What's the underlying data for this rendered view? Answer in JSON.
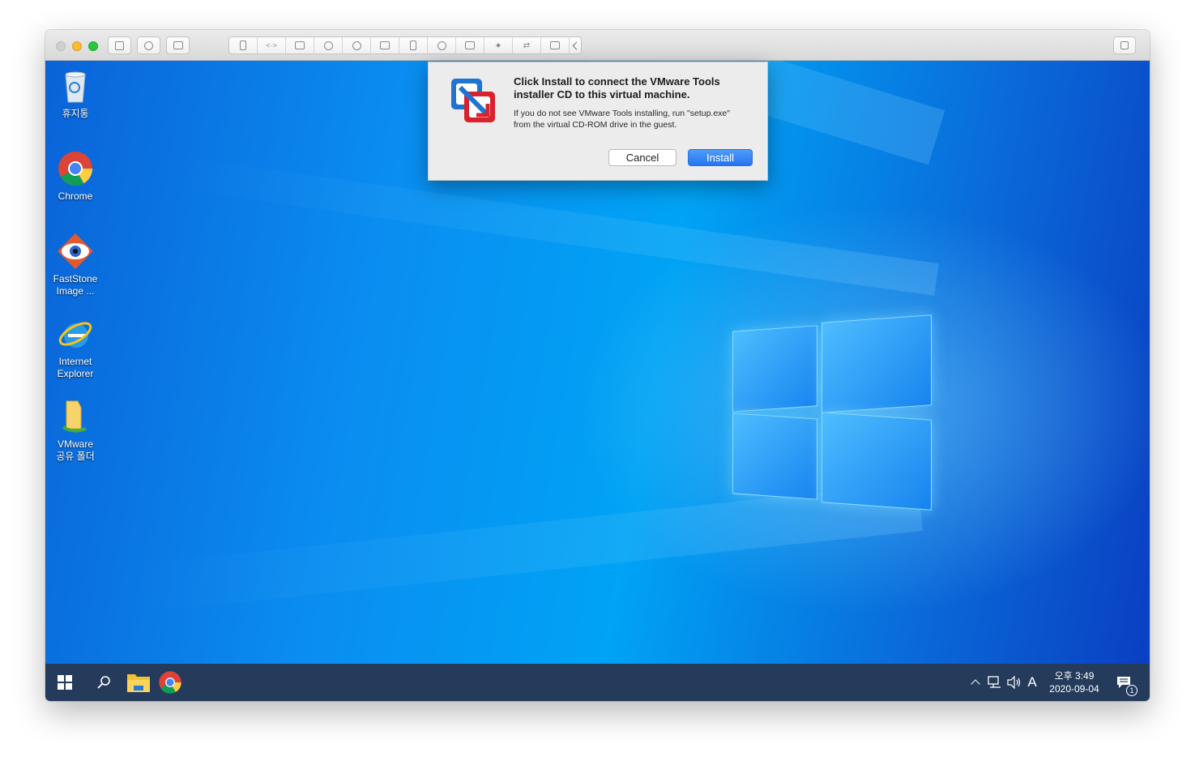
{
  "window": {
    "toolbar_left": [
      "window-icon",
      "info-icon",
      "snapshot-icon"
    ],
    "toolbar_devices": [
      "wrench-icon",
      "code-icon",
      "drive-icon",
      "camera-icon",
      "sound-icon",
      "video-icon",
      "phone-icon",
      "headphones-icon",
      "disk-icon",
      "bluetooth-icon",
      "usb-icon",
      "folder-share-icon",
      "chevron-left-icon"
    ],
    "toolbar_right": "restore-icon"
  },
  "desktop": {
    "icons": [
      {
        "name": "recycle-bin-icon",
        "label_line1": "휴지통",
        "label_line2": ""
      },
      {
        "name": "chrome-icon",
        "label_line1": "Chrome",
        "label_line2": ""
      },
      {
        "name": "faststone-icon",
        "label_line1": "FastStone",
        "label_line2": "Image ..."
      },
      {
        "name": "internet-explorer-icon",
        "label_line1": "Internet",
        "label_line2": "Explorer"
      },
      {
        "name": "vmware-shared-folder-icon",
        "label_line1": "VMware",
        "label_line2": "공유 폴더"
      }
    ]
  },
  "dialog": {
    "title": "Click Install to connect the VMware Tools installer CD to this virtual machine.",
    "body": "If you do not see VMware Tools installing, run \"setup.exe\" from the virtual CD-ROM drive in the guest.",
    "cancel_label": "Cancel",
    "install_label": "Install"
  },
  "taskbar": {
    "tray_lang": "A",
    "time": "오후 3:49",
    "date": "2020-09-04",
    "notification_count": "1"
  },
  "colors": {
    "accent": "#2775ef",
    "desktop_blue": "#0a8df0",
    "taskbar": "#162d50"
  }
}
